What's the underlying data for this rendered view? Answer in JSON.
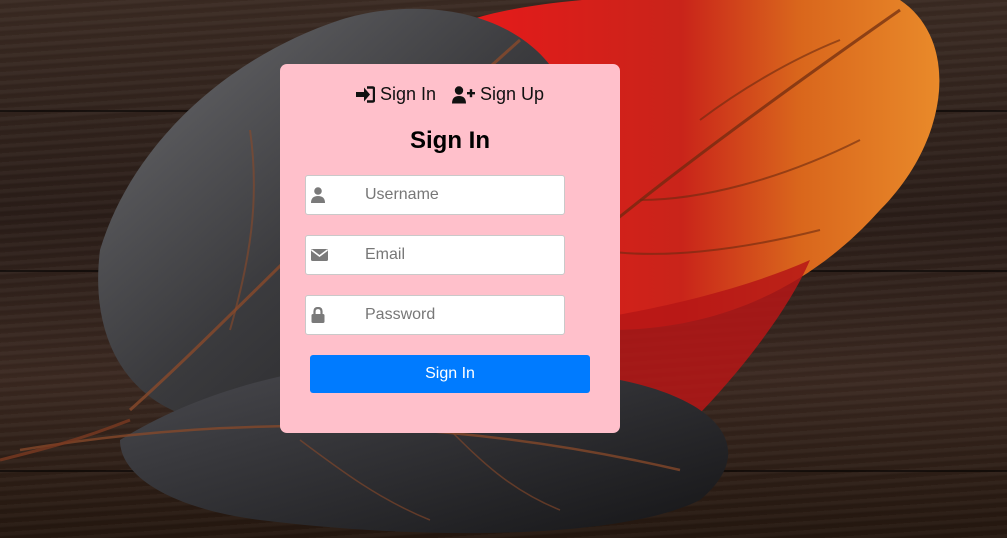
{
  "tabs": {
    "signin_label": "Sign In",
    "signup_label": "Sign Up"
  },
  "form": {
    "title": "Sign In",
    "username": {
      "placeholder": "Username",
      "value": ""
    },
    "email": {
      "placeholder": "Email",
      "value": ""
    },
    "password": {
      "placeholder": "Password",
      "value": ""
    },
    "submit_label": "Sign In"
  },
  "icons": {
    "signin_tab": "sign-in-icon",
    "signup_tab": "user-plus-icon",
    "username": "user-icon",
    "email": "envelope-icon",
    "password": "lock-icon"
  },
  "colors": {
    "card_background": "#ffc0cb",
    "button_background": "#007bff",
    "button_text": "#ffffff",
    "icon_gray": "#7a7a7a"
  }
}
